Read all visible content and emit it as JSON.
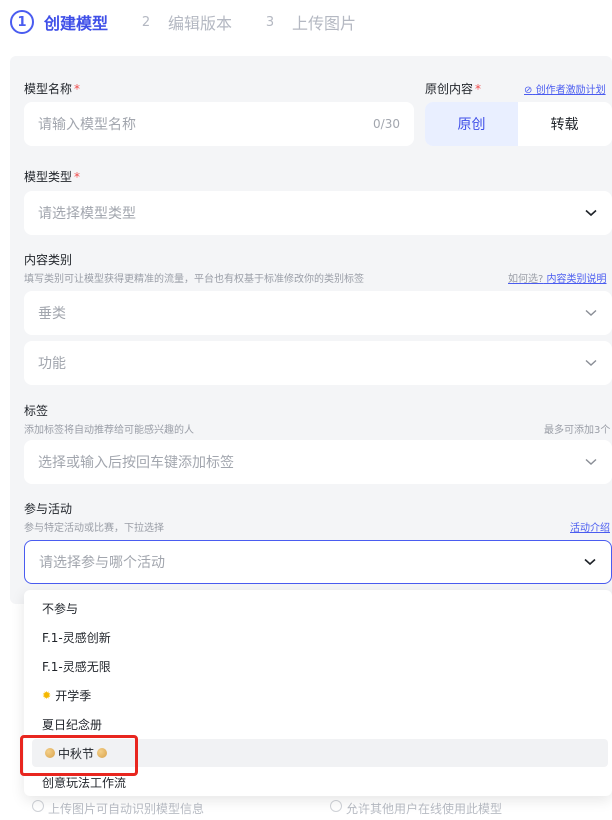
{
  "steps": [
    {
      "num": "1",
      "label": "创建模型"
    },
    {
      "num": "2",
      "label": "编辑版本"
    },
    {
      "num": "3",
      "label": "上传图片"
    }
  ],
  "form": {
    "model_name": {
      "label": "模型名称",
      "required_mark": "*",
      "placeholder": "请输入模型名称",
      "counter": "0/30"
    },
    "original": {
      "label": "原创内容",
      "required_mark": "*",
      "link": "创作者激励计划",
      "options": [
        "原创",
        "转载"
      ],
      "selected": "原创"
    },
    "model_type": {
      "label": "模型类型",
      "required_mark": "*",
      "placeholder": "请选择模型类型"
    },
    "content_category": {
      "label": "内容类别",
      "hint": "填写类别可让模型获得更精准的流量，平台也有权基于标准修改你的类别标签",
      "how_label": "如何选?",
      "how_link": "内容类别说明",
      "vertical_placeholder": "垂类",
      "function_placeholder": "功能"
    },
    "tags": {
      "label": "标签",
      "hint": "添加标签将自动推荐给可能感兴趣的人",
      "limit": "最多可添加3个",
      "placeholder": "选择或输入后按回车键添加标签"
    },
    "activity": {
      "label": "参与活动",
      "hint": "参与特定活动或比赛，下拉选择",
      "link": "活动介绍",
      "placeholder": "请选择参与哪个活动"
    }
  },
  "dropdown": {
    "options": [
      "不参与",
      "F.1-灵感创新",
      "F.1-灵感无限",
      "开学季",
      "夏日纪念册",
      "中秋节",
      "创意玩法工作流"
    ],
    "hovered": "中秋节",
    "highlight_color": "#e8261f"
  },
  "footer_partial": [
    "上传图片可自动识别模型信息",
    "允许其他用户在线使用此模型"
  ],
  "colors": {
    "accent": "#4a5cf0",
    "required": "#f04b4b",
    "panel_bg": "#f4f5f7"
  }
}
